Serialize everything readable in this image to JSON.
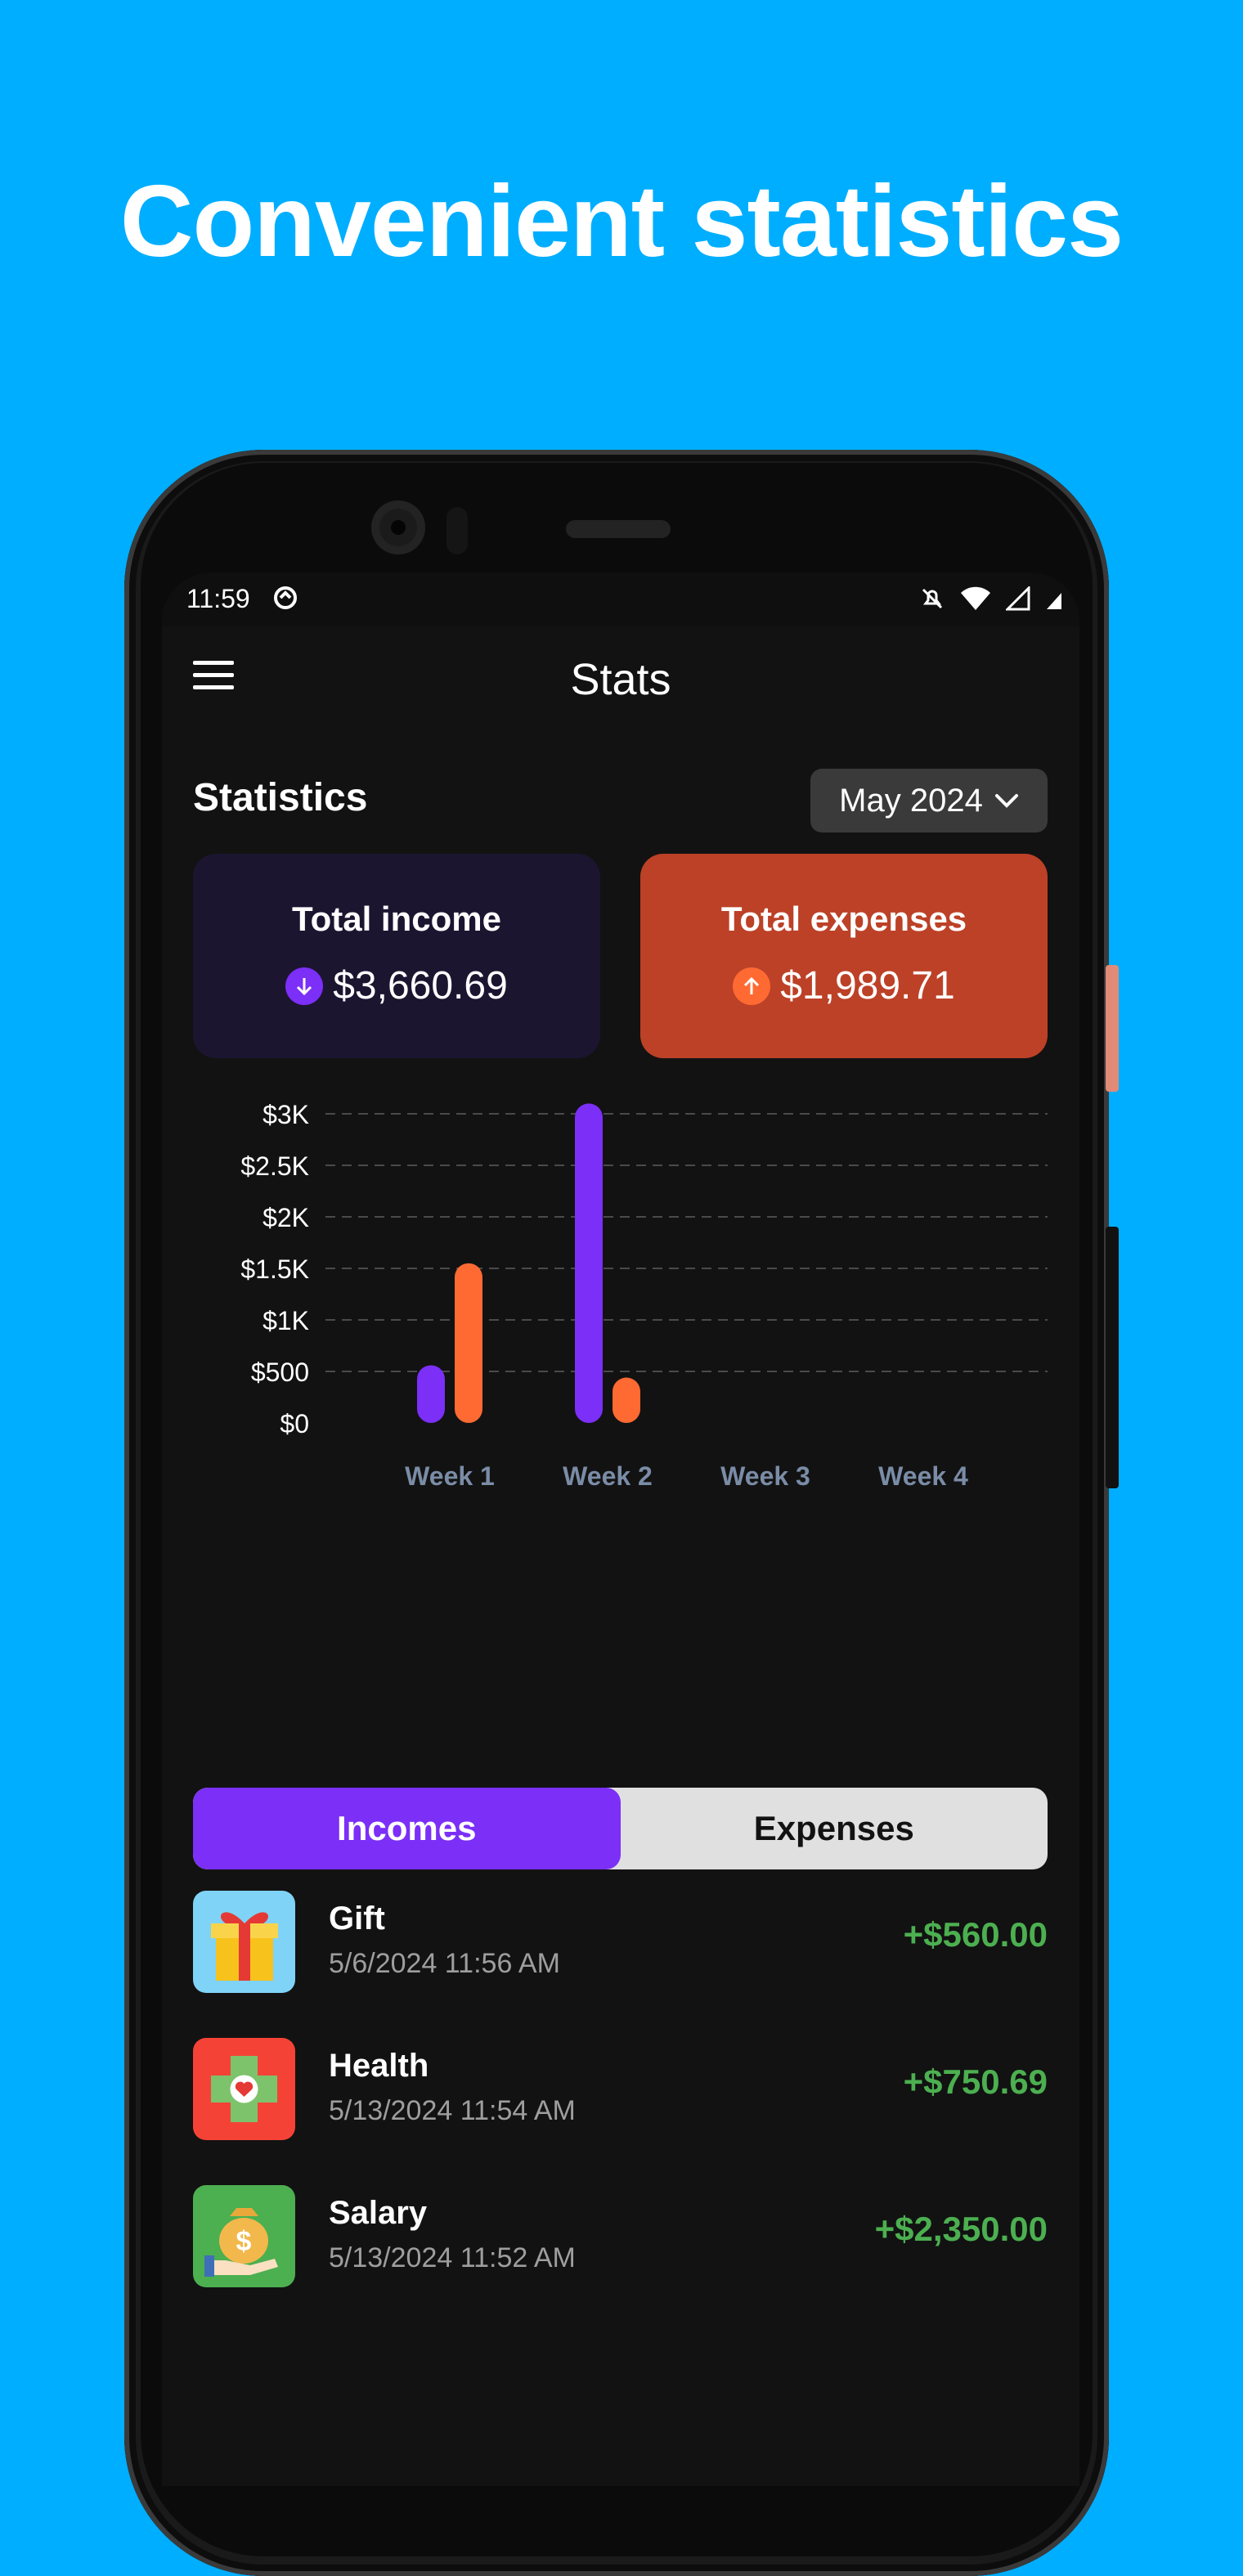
{
  "headline": "Convenient statistics",
  "statusbar": {
    "time": "11:59"
  },
  "appbar": {
    "title": "Stats"
  },
  "section_title": "Statistics",
  "month_selector": {
    "value": "May 2024"
  },
  "cards": {
    "income": {
      "label": "Total income",
      "amount": "$3,660.69"
    },
    "expense": {
      "label": "Total expenses",
      "amount": "$1,989.71"
    }
  },
  "colors": {
    "income": "#7B2FF7",
    "expense": "#FF6A33",
    "positive": "#4CAF50"
  },
  "chart_data": {
    "type": "bar",
    "categories": [
      "Week 1",
      "Week 2",
      "Week 3",
      "Week 4"
    ],
    "series": [
      {
        "values": [
          560,
          3100,
          0,
          0
        ]
      },
      {
        "values": [
          1550,
          440,
          0,
          0
        ]
      }
    ],
    "ylim": [
      0,
      3000
    ],
    "yticks": [
      {
        "value": 0,
        "label": "$0"
      },
      {
        "value": 500,
        "label": "$500"
      },
      {
        "value": 1000,
        "label": "$1K"
      },
      {
        "value": 1500,
        "label": "$1.5K"
      },
      {
        "value": 2000,
        "label": "$2K"
      },
      {
        "value": 2500,
        "label": "$2.5K"
      },
      {
        "value": 3000,
        "label": "$3K"
      }
    ],
    "grid": true
  },
  "tabs": {
    "incomes": "Incomes",
    "expenses": "Expenses"
  },
  "transactions": [
    {
      "name": "Gift",
      "date": "5/6/2024 11:56 AM",
      "amount": "+$560.00",
      "icon": "gift-icon"
    },
    {
      "name": "Health",
      "date": "5/13/2024 11:54 AM",
      "amount": "+$750.69",
      "icon": "health-icon"
    },
    {
      "name": "Salary",
      "date": "5/13/2024 11:52 AM",
      "amount": "+$2,350.00",
      "icon": "salary-icon"
    }
  ]
}
